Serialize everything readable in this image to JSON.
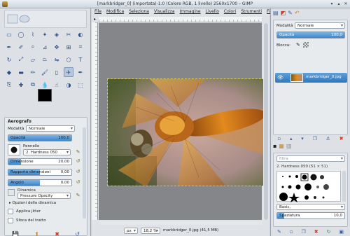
{
  "window": {
    "title": "[markbridger_0] (importata)-1.0 (Colore RGB, 1 livello) 2560x1700 – GIMP",
    "close_glyph": "✕",
    "maximize_glyph": "▴",
    "minimize_glyph": "▾"
  },
  "menubar": {
    "items": [
      "File",
      "Modifica",
      "Seleziona",
      "Visualizza",
      "Immagine",
      "Livello",
      "Colori",
      "Strumenti",
      "Filtri",
      "Finestre",
      "Aiuto"
    ]
  },
  "toolbox": {
    "tools": [
      "rect-select",
      "ellipse-select",
      "free-select",
      "fuzzy-select",
      "by-color-select",
      "scissors",
      "foreground-select",
      "paths",
      "color-picker",
      "zoom",
      "measure",
      "move",
      "align",
      "crop",
      "rotate",
      "scale",
      "shear",
      "perspective",
      "flip",
      "cage",
      "text",
      "bucket-fill",
      "blend",
      "pencil",
      "paintbrush",
      "eraser",
      "airbrush",
      "ink",
      "clone",
      "heal",
      "perspective-clone",
      "blur",
      "smudge",
      "dodge-burn",
      "unified-transform"
    ],
    "active_tool": "airbrush",
    "fg_color": "#000000",
    "bg_color": "#ffffff"
  },
  "tool_options": {
    "title": "Aerografo",
    "mode_label": "Modalità",
    "mode_value": "Normale",
    "opacity_label": "Opacità",
    "opacity_value": "100,0",
    "opacity_fraction": 1.0,
    "brush_label": "Pennello",
    "brush_value": "2. Hardness 050",
    "size_label": "Dimensione",
    "size_value": "20,00",
    "aspect_label": "Rapporto dimensioni",
    "aspect_value": "0,00",
    "angle_label": "Angolo",
    "angle_value": "0,00",
    "dynamics_label": "Dinamica",
    "dynamics_value": "Pressure Opacity",
    "dynamics_options_label": "Opzioni della dinamica",
    "jitter_label": "Applica jitter",
    "smooth_label": "Sfoca del tratto"
  },
  "statusbar": {
    "unit": "px",
    "zoom": "18,2 %",
    "file_info": "markbridger_0.jpg (41,5 MB)"
  },
  "layers_panel": {
    "mode_label": "Modalità",
    "mode_value": "Normale",
    "opacity_label": "Opacità",
    "opacity_value": "100,0",
    "opacity_fraction": 1.0,
    "lock_label": "Blocca:",
    "layer_name": "markbridger_0.jpg"
  },
  "brushes_panel": {
    "filter_placeholder": "filtra",
    "brush_title": "2. Hardness 050 (51 × 51)",
    "tag_value": "Basic,",
    "spacing_label": "Spaziatura",
    "spacing_value": "10,0"
  },
  "colors": {
    "accent": "#3d86c9",
    "selection": "#2e76bd"
  }
}
